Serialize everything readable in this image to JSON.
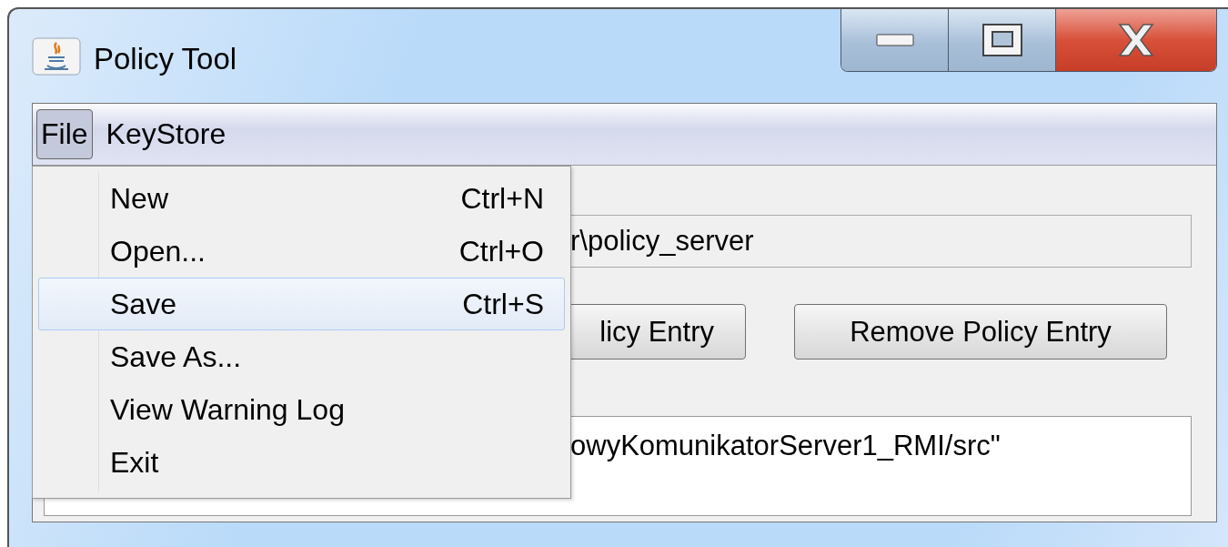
{
  "window": {
    "title": "Policy Tool"
  },
  "menubar": [
    {
      "label": "File",
      "selected": true
    },
    {
      "label": "KeyStore",
      "selected": false
    }
  ],
  "file_menu": [
    {
      "label": "New",
      "shortcut": "Ctrl+N",
      "selected": false
    },
    {
      "label": "Open...",
      "shortcut": "Ctrl+O",
      "selected": false
    },
    {
      "label": "Save",
      "shortcut": "Ctrl+S",
      "selected": true
    },
    {
      "label": "Save As...",
      "selected": false
    },
    {
      "label": "View Warning Log",
      "selected": false
    },
    {
      "label": "Exit",
      "selected": false
    }
  ],
  "policy_file": {
    "value": "r\\policy_server"
  },
  "buttons": [
    "licy Entry",
    "Remove Policy Entry"
  ],
  "entries": [
    "owyKomunikatorServer1_RMI/src\""
  ]
}
